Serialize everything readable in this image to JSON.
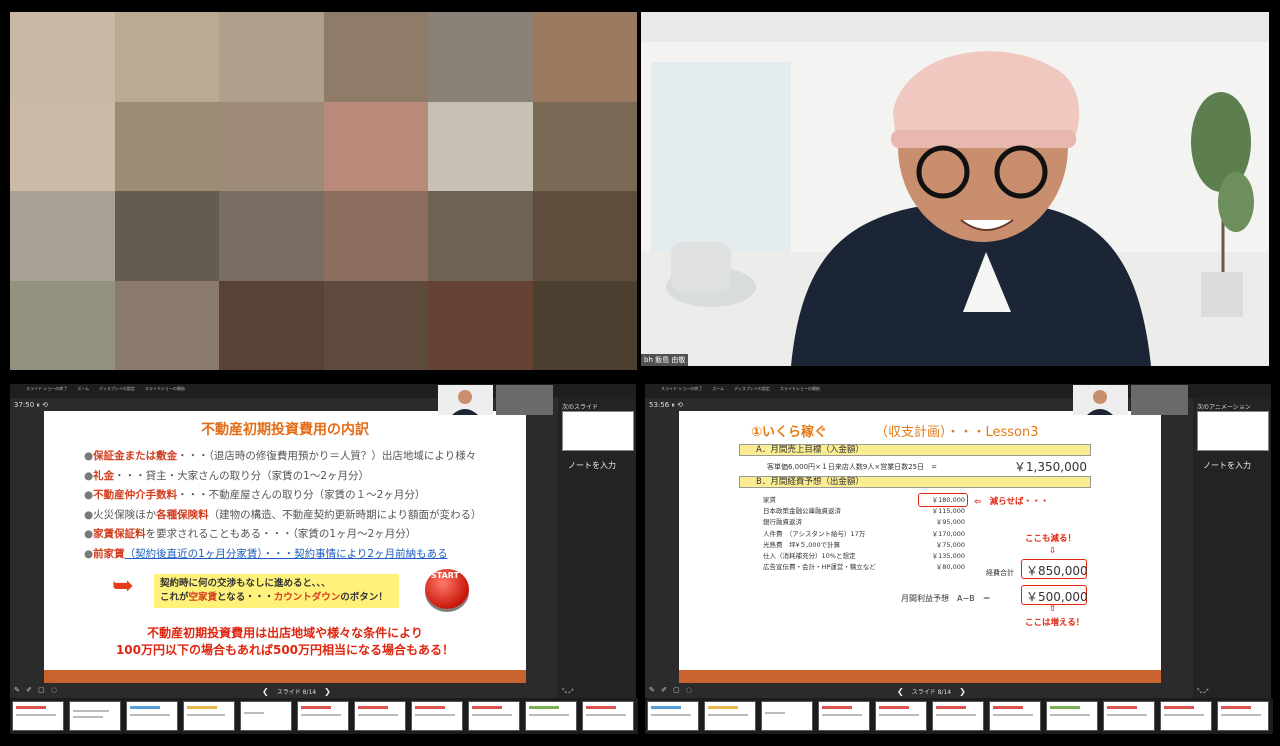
{
  "top_left": {
    "pixel_colors": [
      "#c8b9a4",
      "#b9aa92",
      "#aea08b",
      "#8e7b68",
      "#8a8276",
      "#9a7b62",
      "#cbbaa5",
      "#9c8c74",
      "#9d8b78",
      "#b98a7a",
      "#c8c0b4",
      "#7a6a55",
      "#a8a195",
      "#655c50",
      "#786e62",
      "#8b6e60",
      "#6e6254",
      "#5e4d3d",
      "#94917f",
      "#8a7a6e",
      "#5a4136",
      "#5e4b3e",
      "#654234",
      "#4d3f30"
    ]
  },
  "top_right": {
    "name_label": "bh 飯島 由敬"
  },
  "left_pv": {
    "timer": "37:50 ⏸ ⟲",
    "toolbar": [
      "スライド ショーの終了",
      "ズーム",
      "ディスプレイの設定",
      "スライドショーの開始"
    ],
    "next_label": "次のスライド",
    "notes_placeholder": "ノートを入力",
    "slide_counter": "スライド 8/14",
    "slide": {
      "title": "不動産初期投資費用の内訳",
      "items": [
        {
          "bold": "保証金または敷金",
          "rest": "・・・（退店時の修復費用預かり＝人質？）出店地域により様々"
        },
        {
          "bold": "礼金",
          "rest": "・・・貸主・大家さんの取り分（家賃の1～2ヶ月分）"
        },
        {
          "bold": "不動産仲介手数料",
          "rest": "・・・不動産屋さんの取り分（家賃の１～2ヶ月分）"
        },
        {
          "pre": "火災保険ほか",
          "bold": "各種保険料",
          "rest": "（建物の構造、不動産契約更新時期により額面が変わる）"
        },
        {
          "bold": "家賃保証料",
          "rest": "を要求されることもある・・・（家賃の1ヶ月～2ヶ月分）"
        },
        {
          "bold": "前家賃",
          "rest": "（契約後直近の1ヶ月分家賃）・・・契約事情により2ヶ月前納もある"
        }
      ],
      "box_line1": "契約時に何の交渉もなしに進めると、、、",
      "box_line2a": "これが",
      "box_line2b": "空家賃",
      "box_line2c": "となる・・・",
      "box_line2d": "カウントダウン",
      "box_line2e": "のボタン！",
      "start_label": "START",
      "conclusion1": "不動産初期投資費用は出店地域や様々な条件により",
      "conclusion2": "100万円以下の場合もあれば500万円相当になる場合もある！"
    }
  },
  "right_pv": {
    "timer": "53:56 ⏸ ⟲",
    "toolbar": [
      "スライド ショーの終了",
      "ズーム",
      "ディスプレイの設定",
      "スライドショーの開始"
    ],
    "next_label": "次のアニメーション",
    "notes_placeholder": "ノートを入力",
    "slide_counter": "スライド 8/14",
    "slide": {
      "title1": "①いくら稼ぐ",
      "title2": "（収支計画）・・・Lesson3",
      "hdrA": "A．月間売上目標（入金額）",
      "rowA_label": "客単価6,000円×１日来店人数9人×営業日数25日　=",
      "rowA_value": "￥1,350,000",
      "hdrB": "B．月間経費予想（出金額）",
      "items": [
        "家賃",
        "日本政策金融公庫融資返済",
        "銀行融資返済",
        "人件費　（アシスタント給与）17万",
        "光熱費　坪¥５,000で計算",
        "仕入（消耗補充分）10%と想定",
        "広告宣伝費・会計・HP運営・積立など"
      ],
      "values": [
        "￥180,000",
        "￥115,000",
        "￥95,000",
        "￥170,000",
        "￥75,000",
        "￥135,000",
        "￥80,000"
      ],
      "reduce_note": "⇦　減らせば・・・",
      "here_reduce": "ここも減る！",
      "total_label": "経費合計",
      "total_value": "￥850,000",
      "profit_label": "月間利益予想　A−B　＝",
      "profit_value": "￥500,000",
      "here_increase": "ここは増える！"
    }
  }
}
